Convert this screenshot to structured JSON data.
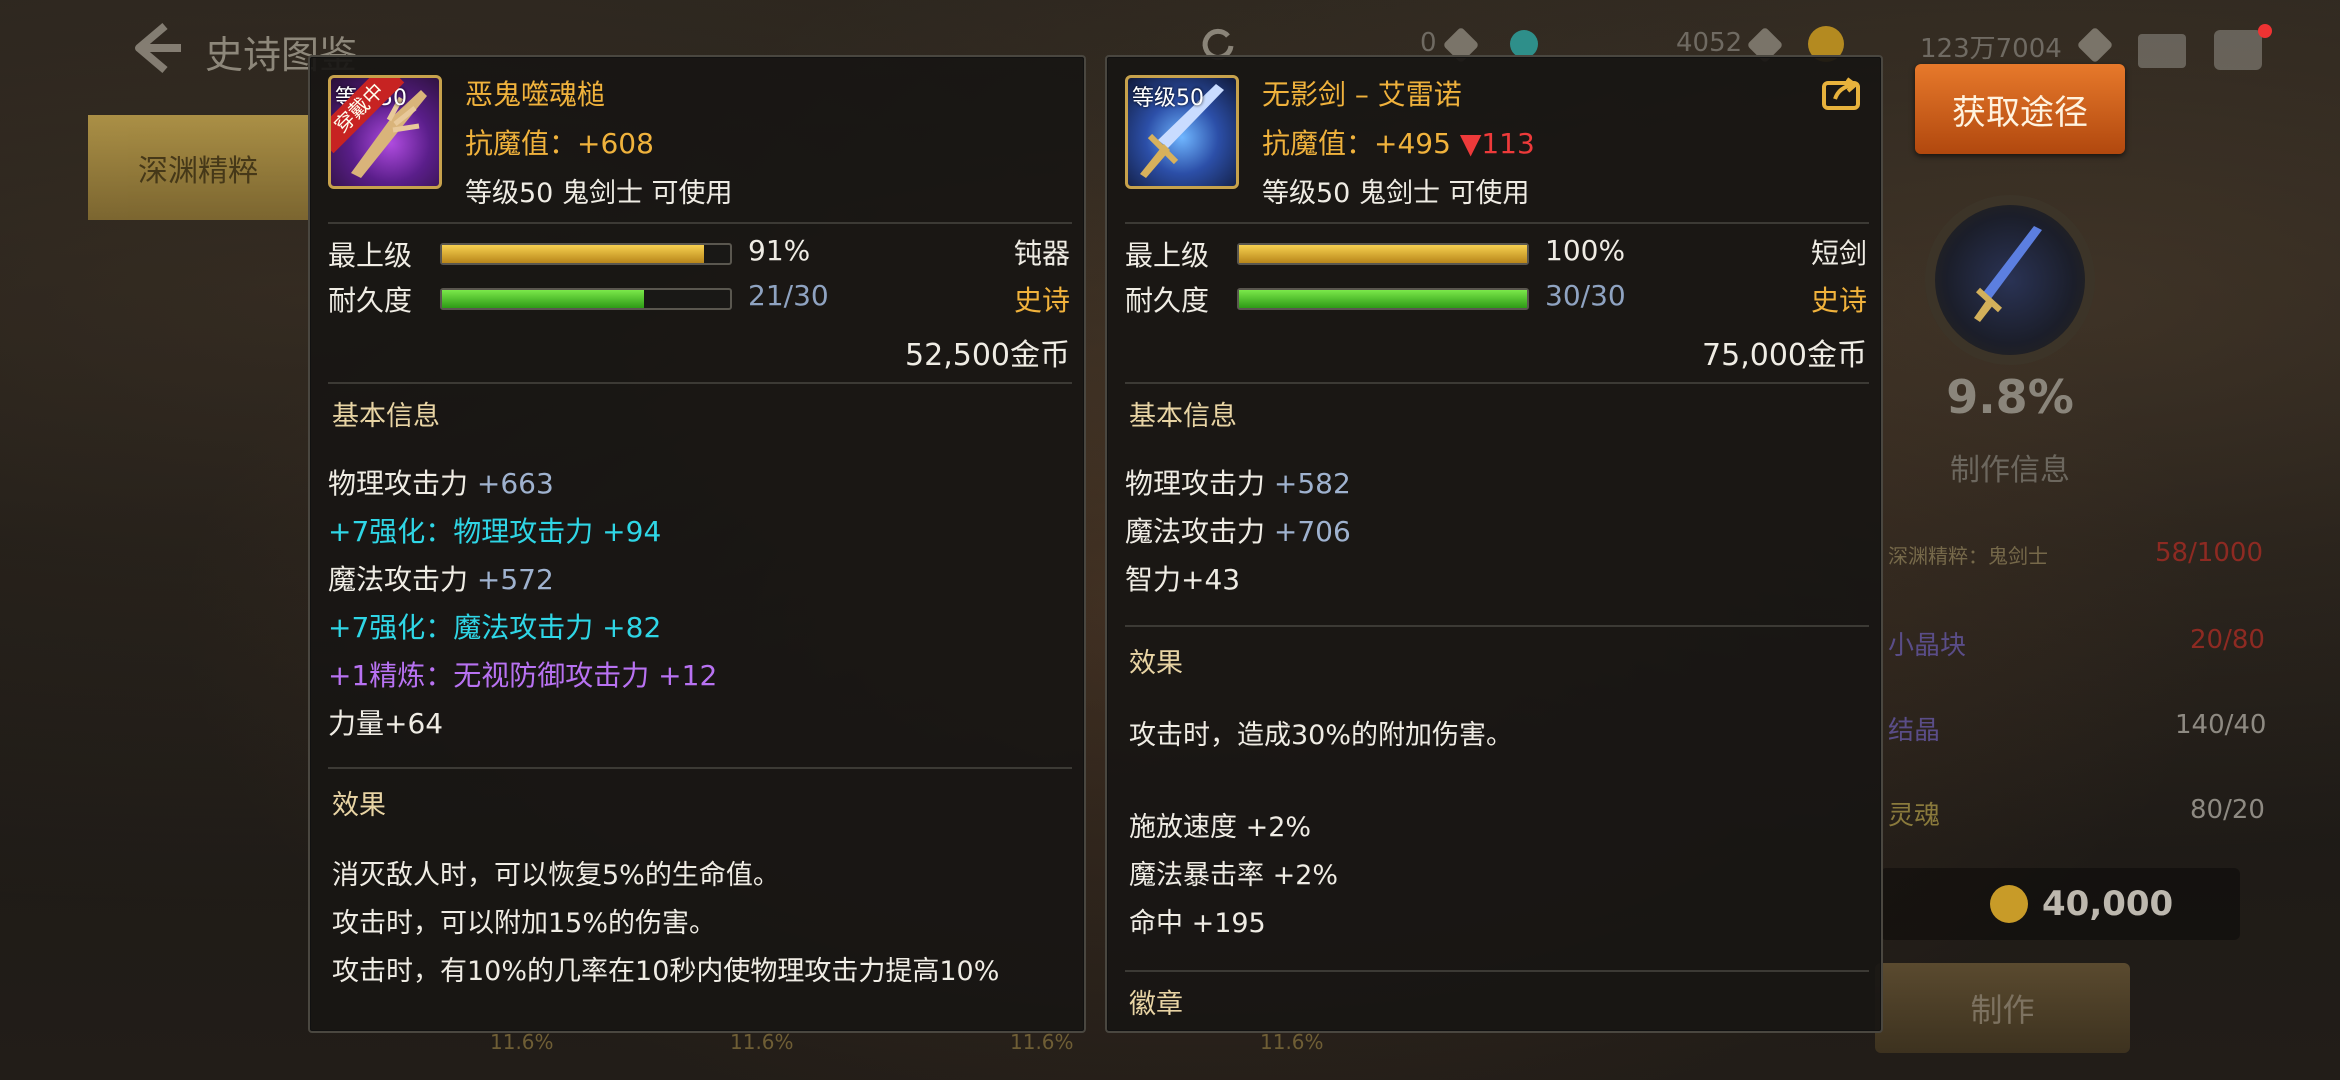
{
  "header": {
    "title": "史诗图鉴",
    "currencies": [
      {
        "value": "0",
        "color": "#9c9386"
      },
      {
        "value": "4052",
        "color": "#9c9386"
      },
      {
        "value": "123万7004",
        "color": "#9c9386"
      }
    ]
  },
  "left_tab": "深渊精粹",
  "side": {
    "source_button": "获取途径",
    "percent": "9.8%",
    "craft_info": "制作信息",
    "materials": [
      {
        "name": "深渊精粹：鬼剑士",
        "count": "58/1000"
      },
      {
        "name": "小晶块",
        "count": "20/80"
      },
      {
        "name": "结晶",
        "count": "140/40"
      },
      {
        "name": "灵魂",
        "count": "80/20"
      }
    ],
    "cost": "40,000",
    "make_button": "制作",
    "bottom_pcts": [
      "11.6%",
      "11.6%",
      "11.6%",
      "11.6%"
    ]
  },
  "item_left": {
    "level_tag": "等级50",
    "equipped": "穿戴中",
    "name": "恶鬼噬魂槌",
    "resist_label": "抗魔值：",
    "resist_value": "+608",
    "usable": "等级50 鬼剑士 可使用",
    "max_label": "最上级",
    "max_value": "91%",
    "max_pct": 91,
    "dur_label": "耐久度",
    "dur_value": "21/30",
    "dur_pct": 70,
    "type": "钝器",
    "grade": "史诗",
    "price": "52,500金币",
    "basic_title": "基本信息",
    "stats": {
      "s1_label": "物理攻击力 ",
      "s1_num": "+663",
      "s2": "+7强化：物理攻击力 +94",
      "s3_label": "魔法攻击力 ",
      "s3_num": "+572",
      "s4": "+7强化：魔法攻击力 +82",
      "s5": "+1精炼：无视防御攻击力 +12",
      "s6": "力量+64"
    },
    "effect_title": "效果",
    "effects": [
      "消灭敌人时，可以恢复5%的生命值。",
      "攻击时，可以附加15%的伤害。",
      "攻击时，有10%的几率在10秒内使物理攻击力提高10%"
    ]
  },
  "item_right": {
    "level_tag": "等级50",
    "name": "无影剑 – 艾雷诺",
    "resist_label": "抗魔值：",
    "resist_value": "+495",
    "resist_diff": "▼113",
    "usable": "等级50 鬼剑士 可使用",
    "max_label": "最上级",
    "max_value": "100%",
    "max_pct": 100,
    "dur_label": "耐久度",
    "dur_value": "30/30",
    "dur_pct": 100,
    "type": "短剑",
    "grade": "史诗",
    "price": "75,000金币",
    "basic_title": "基本信息",
    "stats": {
      "s1_label": "物理攻击力 ",
      "s1_num": "+582",
      "s2_label": "魔法攻击力 ",
      "s2_num": "+706",
      "s3": "智力+43"
    },
    "effect_title": "效果",
    "effects": [
      "攻击时，造成30%的附加伤害。",
      "施放速度 +2%",
      "魔法暴击率 +2%",
      "命中 +195"
    ],
    "badge_title": "徽章"
  }
}
